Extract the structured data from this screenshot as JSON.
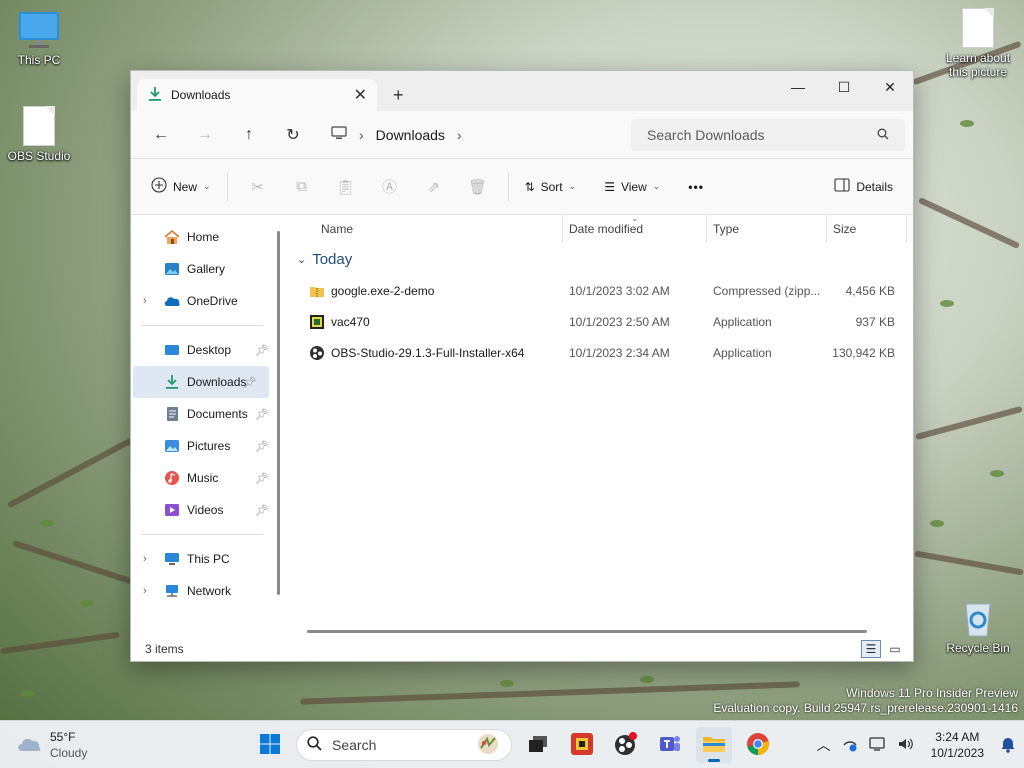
{
  "desktop": {
    "icons": [
      {
        "label": "This PC"
      },
      {
        "label": "OBS Studio"
      },
      {
        "label": "Learn about this picture"
      },
      {
        "label": "Recycle Bin"
      }
    ],
    "watermark": {
      "line1": "Windows 11 Pro Insider Preview",
      "line2": "Evaluation copy. Build 25947.rs_prerelease.230901-1416"
    }
  },
  "window": {
    "tab_label": "Downloads",
    "tab_close": "✕",
    "new_tab": "+",
    "controls": {
      "minimize": "—",
      "maximize": "☐",
      "close": "✕"
    },
    "address": {
      "path": [
        "Downloads"
      ]
    },
    "search": {
      "placeholder": "Search Downloads"
    },
    "toolbar": {
      "new": "New",
      "sort": "Sort",
      "view": "View",
      "more": "•••",
      "details": "Details"
    },
    "nav": {
      "quick": [
        {
          "label": "Home",
          "icon": "home-icon"
        },
        {
          "label": "Gallery",
          "icon": "gallery-icon"
        },
        {
          "label": "OneDrive",
          "icon": "onedrive-icon"
        }
      ],
      "pinned": [
        {
          "label": "Desktop",
          "icon": "desktop-icon"
        },
        {
          "label": "Downloads",
          "icon": "download-icon"
        },
        {
          "label": "Documents",
          "icon": "documents-icon"
        },
        {
          "label": "Pictures",
          "icon": "pictures-icon"
        },
        {
          "label": "Music",
          "icon": "music-icon"
        },
        {
          "label": "Videos",
          "icon": "videos-icon"
        }
      ],
      "devices": [
        {
          "label": "This PC",
          "icon": "this-pc-icon"
        },
        {
          "label": "Network",
          "icon": "network-icon"
        }
      ]
    },
    "columns": {
      "name": "Name",
      "date": "Date modified",
      "type": "Type",
      "size": "Size"
    },
    "group": "Today",
    "files": [
      {
        "name": "google.exe-2-demo",
        "date": "10/1/2023 3:02 AM",
        "type": "Compressed (zipp...",
        "size": "4,456 KB",
        "icon": "zip-folder-icon"
      },
      {
        "name": "vac470",
        "date": "10/1/2023 2:50 AM",
        "type": "Application",
        "size": "937 KB",
        "icon": "application-icon"
      },
      {
        "name": "OBS-Studio-29.1.3-Full-Installer-x64",
        "date": "10/1/2023 2:34 AM",
        "type": "Application",
        "size": "130,942 KB",
        "icon": "obs-installer-icon"
      }
    ],
    "status": "3 items"
  },
  "taskbar": {
    "weather": {
      "temp": "55°F",
      "condition": "Cloudy"
    },
    "search_label": "Search",
    "clock": {
      "time": "3:24 AM",
      "date": "10/1/2023"
    }
  },
  "colors": {
    "accent": "#0067c0",
    "selection": "#dfe7f2",
    "group_header": "#1f4e79"
  }
}
